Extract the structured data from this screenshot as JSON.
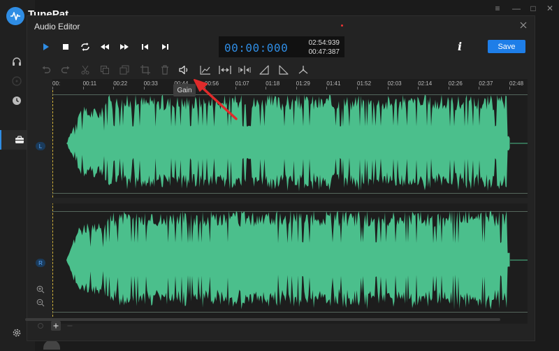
{
  "app": {
    "name": "TunePat"
  },
  "window_controls": {
    "menu": "≡",
    "minimize": "—",
    "maximize": "□",
    "close": "✕"
  },
  "dialog": {
    "title": "Audio Editor",
    "time": {
      "current": "00:00:000",
      "total": "02:54:939",
      "selection": "00:47:387"
    },
    "save_label": "Save",
    "info_label": "i",
    "transport": [
      "play-icon",
      "stop-icon",
      "loop-icon",
      "rewind-icon",
      "fast-forward-icon",
      "skip-start-icon",
      "skip-end-icon"
    ],
    "tools": [
      "undo-icon",
      "redo-icon",
      "cut-icon",
      "copy-icon",
      "paste-icon",
      "crop-icon",
      "delete-icon",
      "gain-icon",
      "fade-icon",
      "expand-icon",
      "shrink-icon",
      "fade-in-icon",
      "fade-out-icon",
      "merge-icon"
    ],
    "tooltip": "Gain"
  },
  "timeline": {
    "ticks": [
      "00:",
      "00:11",
      "00:22",
      "00:33",
      "00:44",
      "00:56",
      "01:07",
      "01:18",
      "01:29",
      "01:41",
      "01:52",
      "02:03",
      "02:14",
      "02:26",
      "02:37",
      "02:48"
    ]
  },
  "channels": {
    "left": "L",
    "right": "R"
  },
  "colors": {
    "accent": "#1e7ee8",
    "waveform": "#4bbf8c",
    "background": "#1d1d1d",
    "arrow": "#e02b2b"
  }
}
